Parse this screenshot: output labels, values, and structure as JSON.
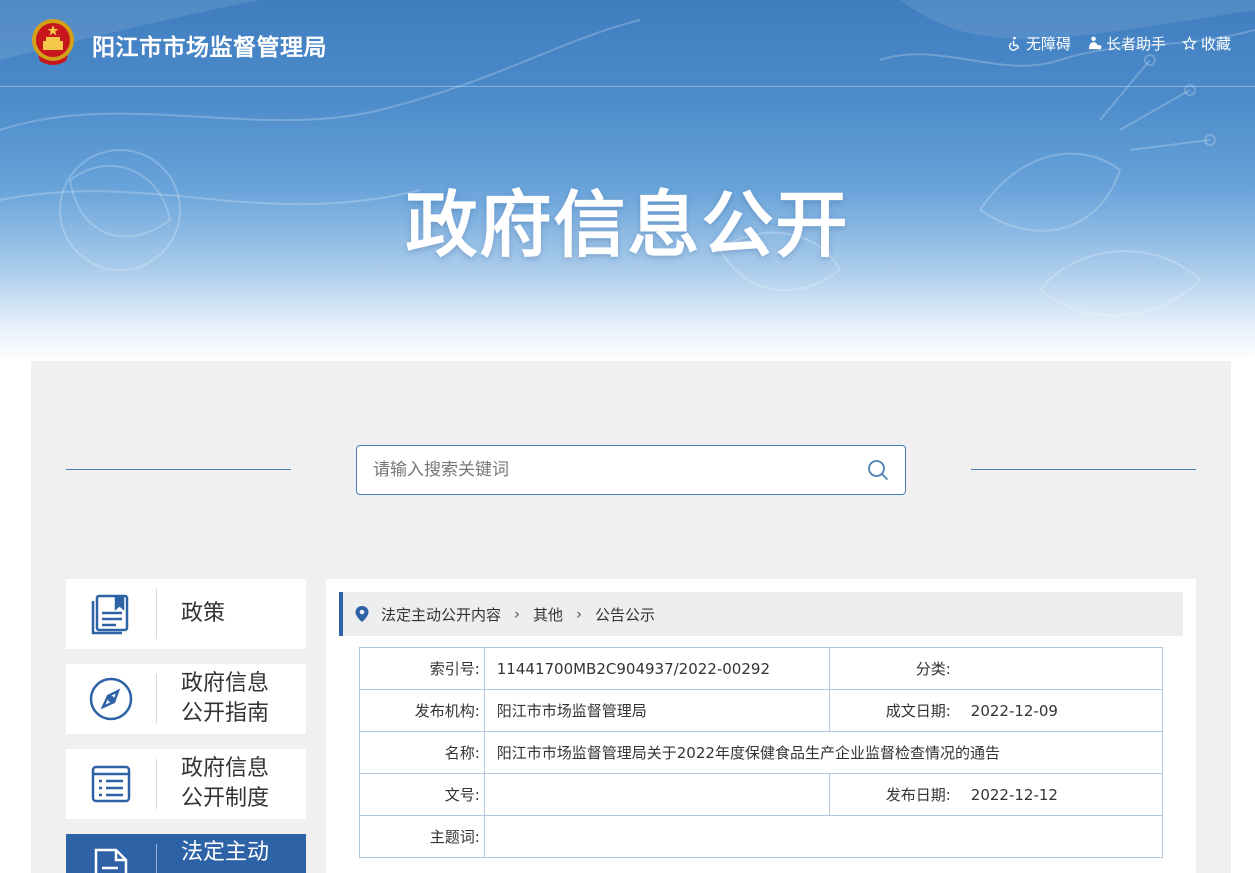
{
  "header": {
    "site_title": "阳江市市场监督管理局",
    "links": [
      {
        "label": "无障碍",
        "icon": "wheelchair-icon"
      },
      {
        "label": "长者助手",
        "icon": "elder-icon"
      },
      {
        "label": "收藏",
        "icon": "star-icon"
      }
    ]
  },
  "hero": {
    "title": "政府信息公开"
  },
  "search": {
    "placeholder": "请输入搜索关键词",
    "value": ""
  },
  "sidebar": {
    "items": [
      {
        "label": "政策",
        "icon": "policy-book-icon",
        "active": false
      },
      {
        "label": "政府信息公开指南",
        "line1": "政府信息",
        "line2": "公开指南",
        "icon": "compass-icon",
        "active": false
      },
      {
        "label": "政府信息公开制度",
        "line1": "政府信息",
        "line2": "公开制度",
        "icon": "document-list-icon",
        "active": false
      },
      {
        "label": "法定主动",
        "icon": "document-edit-icon",
        "active": true
      }
    ]
  },
  "breadcrumb": {
    "items": [
      "法定主动公开内容",
      "其他",
      "公告公示"
    ]
  },
  "info": {
    "index_label": "索引号:",
    "index_value": "11441700MB2C904937/2022-00292",
    "category_label": "分类:",
    "category_value": "",
    "publisher_label": "发布机构:",
    "publisher_value": "阳江市市场监督管理局",
    "created_label": "成文日期:",
    "created_value": "2022-12-09",
    "name_label": "名称:",
    "name_value": "阳江市市场监督管理局关于2022年度保健食品生产企业监督检查情况的通告",
    "docno_label": "文号:",
    "docno_value": "",
    "published_label": "发布日期:",
    "published_value": "2022-12-12",
    "keywords_label": "主题词:",
    "keywords_value": ""
  },
  "colors": {
    "brand_blue": "#2e62a6",
    "banner_blue": "#4d8ccb",
    "table_border": "#b3c8e0",
    "page_bg": "#f0f0f0"
  }
}
